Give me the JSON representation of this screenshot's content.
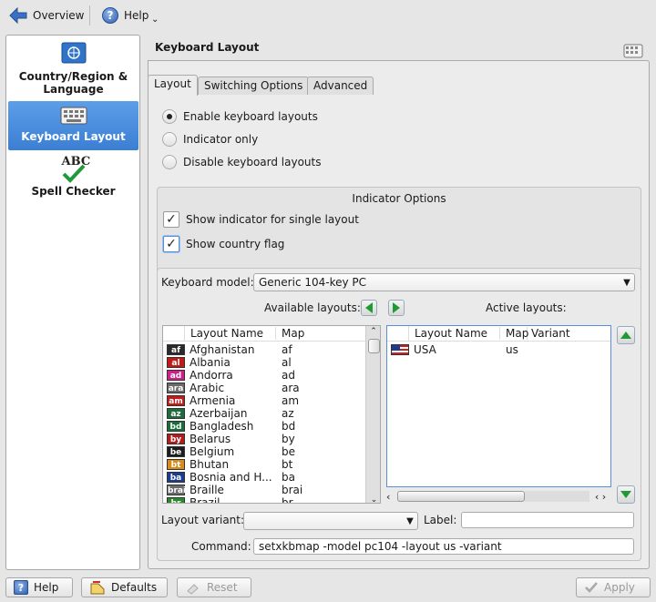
{
  "toolbar": {
    "overview": "Overview",
    "help": "Help",
    "more_icon": "chevron-down-icon"
  },
  "sidebar": {
    "items": [
      {
        "label": "Country/Region & Language",
        "icon": "flag-icon"
      },
      {
        "label": "Keyboard Layout",
        "icon": "keyboard-icon"
      },
      {
        "label": "Spell Checker",
        "icon": "abc-check-icon",
        "icon_text": "ABC"
      }
    ]
  },
  "page": {
    "title": "Keyboard Layout"
  },
  "tabs": [
    "Layout",
    "Switching Options",
    "Advanced"
  ],
  "layout_mode": {
    "options": [
      "Enable keyboard layouts",
      "Indicator only",
      "Disable keyboard layouts"
    ],
    "selected": "Enable keyboard layouts"
  },
  "indicator": {
    "title": "Indicator Options",
    "single": "Show indicator for single layout",
    "flag": "Show country flag"
  },
  "keyboard": {
    "model_label": "Keyboard model:",
    "model_value": "Generic 104-key PC"
  },
  "available": {
    "label": "Available layouts:",
    "col_name": "Layout Name",
    "col_map": "Map",
    "rows": [
      {
        "flag": "af",
        "name": "Afghanistan",
        "map": "af",
        "color": "#2a2a2a"
      },
      {
        "flag": "al",
        "name": "Albania",
        "map": "al",
        "color": "#c21818"
      },
      {
        "flag": "ad",
        "name": "Andorra",
        "map": "ad",
        "color": "#cf1f8a"
      },
      {
        "flag": "ara",
        "name": "Arabic",
        "map": "ara",
        "color": "#6a6a6a"
      },
      {
        "flag": "am",
        "name": "Armenia",
        "map": "am",
        "color": "#c01c1c"
      },
      {
        "flag": "az",
        "name": "Azerbaijan",
        "map": "az",
        "color": "#1f6b3b"
      },
      {
        "flag": "bd",
        "name": "Bangladesh",
        "map": "bd",
        "color": "#1a6e3a"
      },
      {
        "flag": "by",
        "name": "Belarus",
        "map": "by",
        "color": "#b51b1b"
      },
      {
        "flag": "be",
        "name": "Belgium",
        "map": "be",
        "color": "#1c1c1c"
      },
      {
        "flag": "bt",
        "name": "Bhutan",
        "map": "bt",
        "color": "#d88a1a"
      },
      {
        "flag": "ba",
        "name": "Bosnia and H...",
        "map": "ba",
        "color": "#1b3d91"
      },
      {
        "flag": "brai",
        "name": "Braille",
        "map": "brai",
        "color": "#6b6b6b"
      },
      {
        "flag": "br",
        "name": "Brazil",
        "map": "br",
        "color": "#2a8a2a"
      }
    ]
  },
  "active": {
    "label": "Active layouts:",
    "col_name": "Layout Name",
    "col_map": "Map",
    "col_variant": "Variant",
    "rows": [
      {
        "flag": "us",
        "name": "USA",
        "map": "us",
        "variant": ""
      }
    ]
  },
  "variant": {
    "label": "Layout variant:",
    "value": ""
  },
  "label_field": {
    "label": "Label:",
    "value": ""
  },
  "command": {
    "label": "Command:",
    "value": "setxkbmap -model pc104 -layout us -variant"
  },
  "buttons": {
    "help": "Help",
    "defaults": "Defaults",
    "reset": "Reset",
    "apply": "Apply"
  }
}
